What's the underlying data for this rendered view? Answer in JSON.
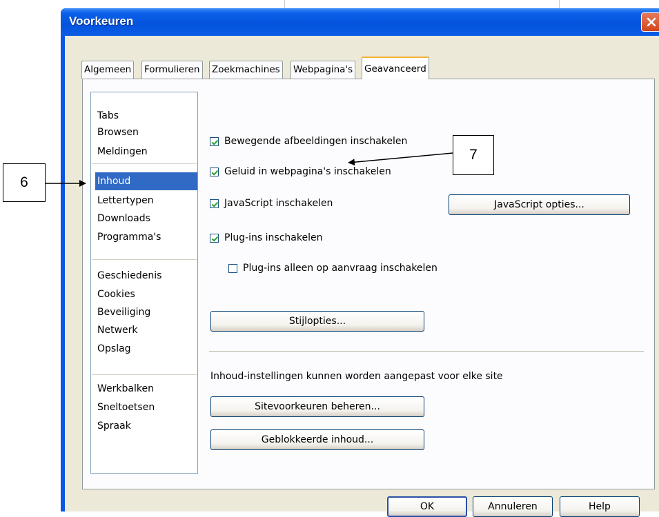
{
  "window": {
    "title": "Voorkeuren"
  },
  "tabs": [
    {
      "label": "Algemeen",
      "active": false
    },
    {
      "label": "Formulieren",
      "active": false
    },
    {
      "label": "Zoekmachines",
      "active": false
    },
    {
      "label": "Webpagina's",
      "active": false
    },
    {
      "label": "Geavanceerd",
      "active": true
    }
  ],
  "sidebar": {
    "items": [
      {
        "label": "Tabs"
      },
      {
        "label": "Browsen"
      },
      {
        "label": "Meldingen"
      },
      {
        "label": "Inhoud",
        "selected": true
      },
      {
        "label": "Lettertypen"
      },
      {
        "label": "Downloads"
      },
      {
        "label": "Programma's"
      },
      {
        "label": "Geschiedenis"
      },
      {
        "label": "Cookies"
      },
      {
        "label": "Beveiliging"
      },
      {
        "label": "Netwerk"
      },
      {
        "label": "Opslag"
      },
      {
        "label": "Werkbalken"
      },
      {
        "label": "Sneltoetsen"
      },
      {
        "label": "Spraak"
      }
    ]
  },
  "content": {
    "checkboxes": [
      {
        "label": "Bewegende afbeeldingen inschakelen",
        "checked": true
      },
      {
        "label": "Geluid in webpagina's inschakelen",
        "checked": true
      },
      {
        "label": "JavaScript inschakelen",
        "checked": true
      },
      {
        "label": "Plug-ins inschakelen",
        "checked": true
      },
      {
        "label": "Plug-ins alleen op aanvraag inschakelen",
        "checked": false
      }
    ],
    "javascript_options_label": "JavaScript opties...",
    "style_options_label": "Stijlopties...",
    "site_settings_text": "Inhoud-instellingen kunnen worden aangepast voor elke site",
    "manage_site_prefs_label": "Sitevoorkeuren beheren...",
    "blocked_content_label": "Geblokkeerde inhoud..."
  },
  "footer": {
    "ok_label": "OK",
    "cancel_label": "Annuleren",
    "help_label": "Help"
  },
  "annotations": {
    "callout_6": "6",
    "callout_7": "7"
  },
  "colors": {
    "titlebar": "#0353dd",
    "selection": "#316ac5",
    "checkmark": "#21a121",
    "dialog_bg": "#ece9d8"
  }
}
